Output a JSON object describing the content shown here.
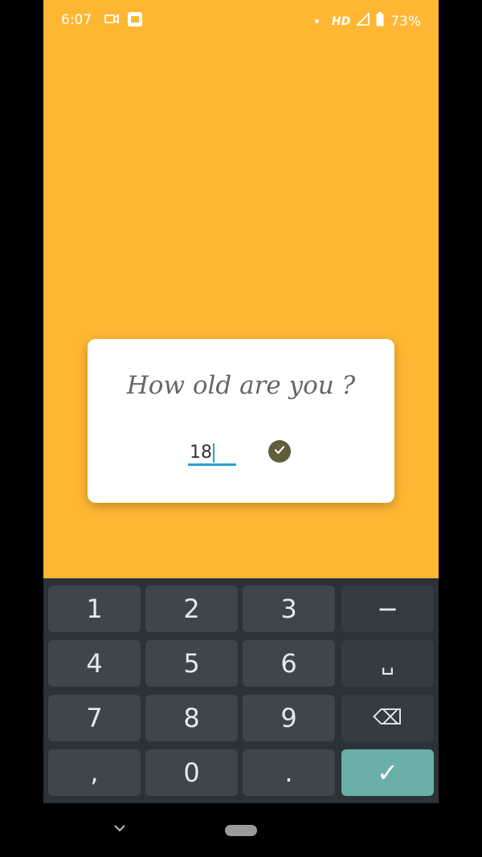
{
  "status_bar": {
    "time": "6:07",
    "icons": [
      "video-camera-icon",
      "notification-app-icon",
      "dot-icon",
      "signal-icon",
      "battery-icon"
    ],
    "network": "HD",
    "battery": "73%"
  },
  "dialog": {
    "title": "How old are you ?",
    "age_value": "18",
    "confirm_icon": "check-circle-icon"
  },
  "keyboard": {
    "keys": [
      "1",
      "2",
      "3",
      "−",
      "4",
      "5",
      "6",
      "␣",
      "7",
      "8",
      "9",
      "⌫",
      ",",
      "0",
      ".",
      "✓"
    ]
  },
  "colors": {
    "background": "#ffb733",
    "keyboard": "#2b3238",
    "enter_key": "#6ab0a8",
    "input_underline": "#2aa0d8"
  }
}
